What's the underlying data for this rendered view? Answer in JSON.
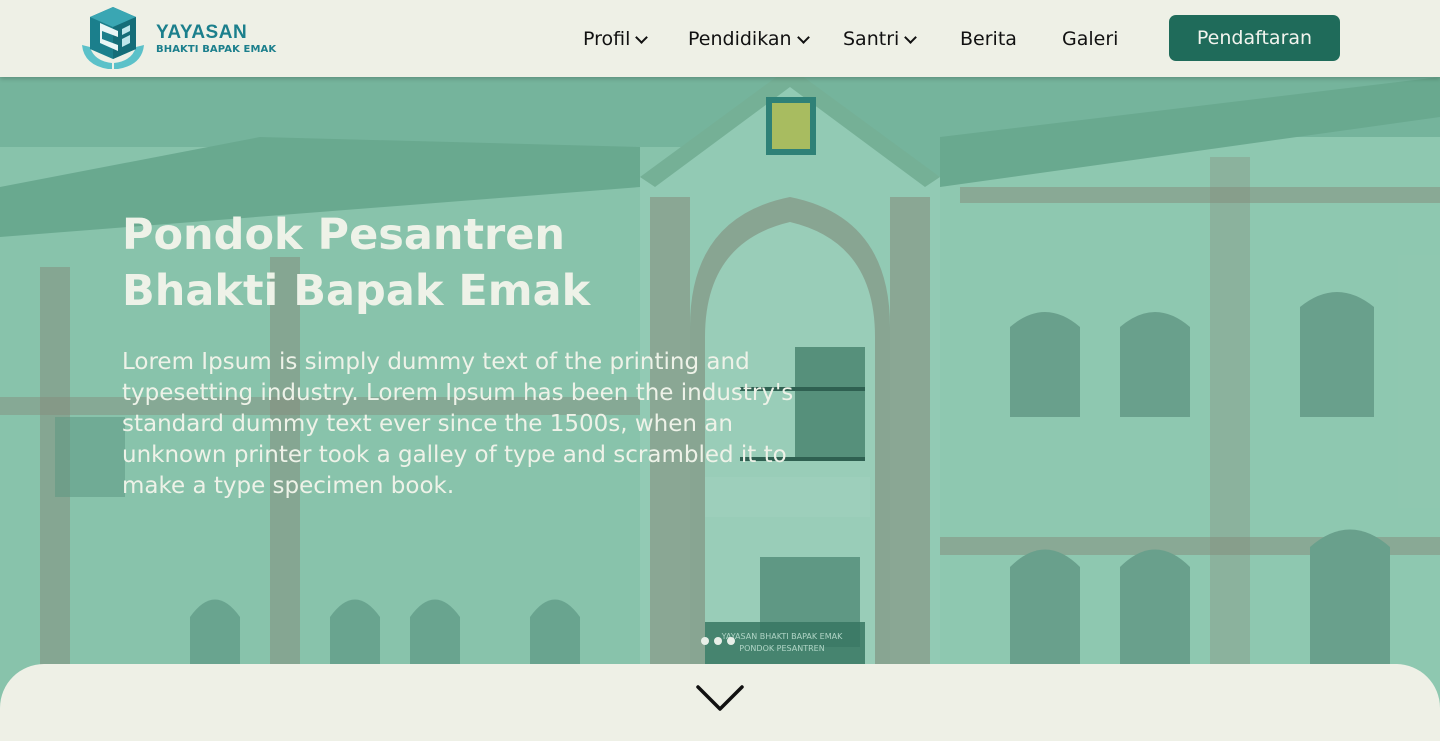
{
  "brand": {
    "title": "YAYASAN",
    "subtitle": "BHAKTI BAPAK EMAK",
    "accent": "#1b7f8c",
    "icon": "logo-icon"
  },
  "nav": {
    "items": [
      {
        "label": "Profil",
        "dropdown": true
      },
      {
        "label": "Pendidikan",
        "dropdown": true
      },
      {
        "label": "Santri",
        "dropdown": true
      },
      {
        "label": "Berita",
        "dropdown": false
      },
      {
        "label": "Galeri",
        "dropdown": false
      }
    ],
    "cta_label": "Pendaftaran",
    "cta_color": "#1f6b5a"
  },
  "hero": {
    "title_line1": "Pondok Pesantren",
    "title_line2": "Bhakti Bapak Emak",
    "description": "Lorem Ipsum is simply dummy text of the printing and typesetting industry. Lorem Ipsum has been the industry's standard dummy text ever since the 1500s, when an unknown printer took a galley of type and scrambled it to make a type specimen book.",
    "sign_text_1": "YAYASAN BHAKTI BAPAK EMAK",
    "sign_text_2": "PONDOK PESANTREN",
    "slides_count": 3,
    "overlay_color": "#348c6e"
  },
  "scroll_icon": "chevron-down-icon"
}
